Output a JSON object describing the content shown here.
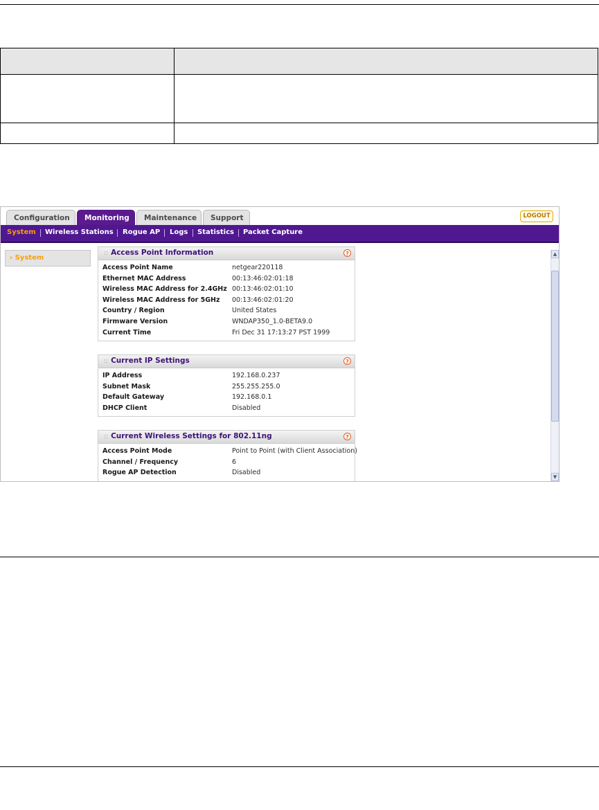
{
  "tabs": [
    {
      "label": "Configuration"
    },
    {
      "label": "Monitoring"
    },
    {
      "label": "Maintenance"
    },
    {
      "label": "Support"
    }
  ],
  "logout_label": "LOGOUT",
  "subnav": [
    {
      "label": "System"
    },
    {
      "label": "Wireless Stations"
    },
    {
      "label": "Rogue AP"
    },
    {
      "label": "Logs"
    },
    {
      "label": "Statistics"
    },
    {
      "label": "Packet Capture"
    }
  ],
  "sidebar": {
    "item": "System"
  },
  "panels": [
    {
      "title": "Access Point Information",
      "rows": [
        {
          "label": "Access Point Name",
          "value": "netgear220118"
        },
        {
          "label": "Ethernet MAC Address",
          "value": "00:13:46:02:01:18"
        },
        {
          "label": "Wireless MAC Address for 2.4GHz",
          "value": "00:13:46:02:01:10"
        },
        {
          "label": "Wireless MAC Address for 5GHz",
          "value": "00:13:46:02:01:20"
        },
        {
          "label": "Country / Region",
          "value": "United States"
        },
        {
          "label": "Firmware Version",
          "value": "WNDAP350_1.0-BETA9.0"
        },
        {
          "label": "Current Time",
          "value": "Fri Dec 31 17:13:27 PST 1999"
        }
      ]
    },
    {
      "title": "Current IP Settings",
      "rows": [
        {
          "label": "IP Address",
          "value": "192.168.0.237"
        },
        {
          "label": "Subnet Mask",
          "value": "255.255.255.0"
        },
        {
          "label": "Default Gateway",
          "value": "192.168.0.1"
        },
        {
          "label": "DHCP Client",
          "value": "Disabled"
        }
      ]
    },
    {
      "title": "Current Wireless Settings for 802.11ng",
      "rows": [
        {
          "label": "Access Point Mode",
          "value": "Point to Point (with Client Association)"
        },
        {
          "label": "Channel / Frequency",
          "value": "6"
        },
        {
          "label": "Rogue AP Detection",
          "value": "Disabled"
        }
      ]
    }
  ],
  "icons": {
    "help": "?",
    "arrow": "›",
    "grip": "::",
    "scroll_up": "▲",
    "scroll_down": "▼"
  },
  "colors": {
    "accent_purple": "#4f1890",
    "active_orange": "#ff9c00",
    "logout_gold": "#e0a800"
  }
}
